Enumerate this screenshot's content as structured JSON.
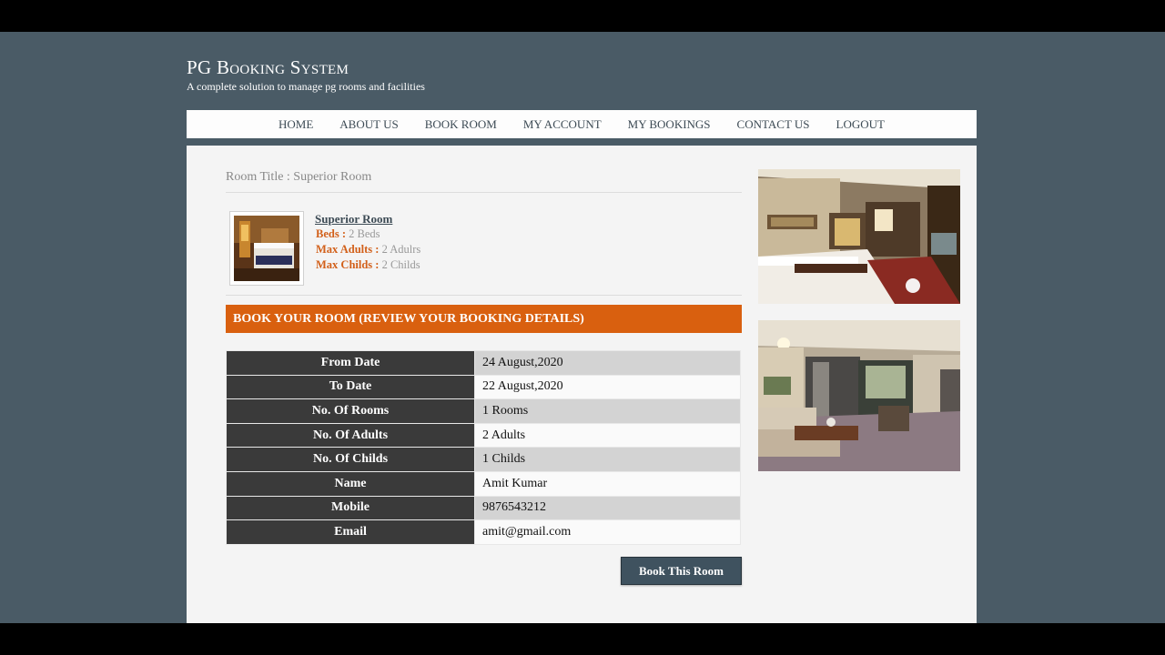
{
  "site": {
    "title": "PG Booking System",
    "tagline": "A complete solution to manage pg rooms and facilities"
  },
  "nav": [
    "HOME",
    "ABOUT US",
    "BOOK ROOM",
    "MY ACCOUNT",
    "MY BOOKINGS",
    "CONTACT US",
    "LOGOUT"
  ],
  "room": {
    "title_line": "Room Title : Superior Room",
    "name": "Superior Room",
    "beds_label": "Beds :",
    "beds_value": "2 Beds",
    "adults_label": "Max Adults :",
    "adults_value": "2 Adulrs",
    "childs_label": "Max Childs :",
    "childs_value": "2 Childs"
  },
  "booking": {
    "heading": "BOOK YOUR ROOM (REVIEW YOUR BOOKING DETAILS)",
    "rows": [
      {
        "label": "From Date",
        "value": "24 August,2020"
      },
      {
        "label": "To Date",
        "value": "22 August,2020"
      },
      {
        "label": "No. Of Rooms",
        "value": "1 Rooms"
      },
      {
        "label": "No. Of Adults",
        "value": "2 Adults"
      },
      {
        "label": "No. Of Childs",
        "value": "1 Childs"
      },
      {
        "label": "Name",
        "value": "Amit Kumar"
      },
      {
        "label": "Mobile",
        "value": "9876543212"
      },
      {
        "label": "Email",
        "value": "amit@gmail.com"
      }
    ],
    "button_label": "Book This Room"
  },
  "colors": {
    "page_background": "#4a5b66",
    "accent_orange": "#d9600f",
    "table_label_background": "#3a3a3a",
    "button_background": "#3f525f"
  }
}
